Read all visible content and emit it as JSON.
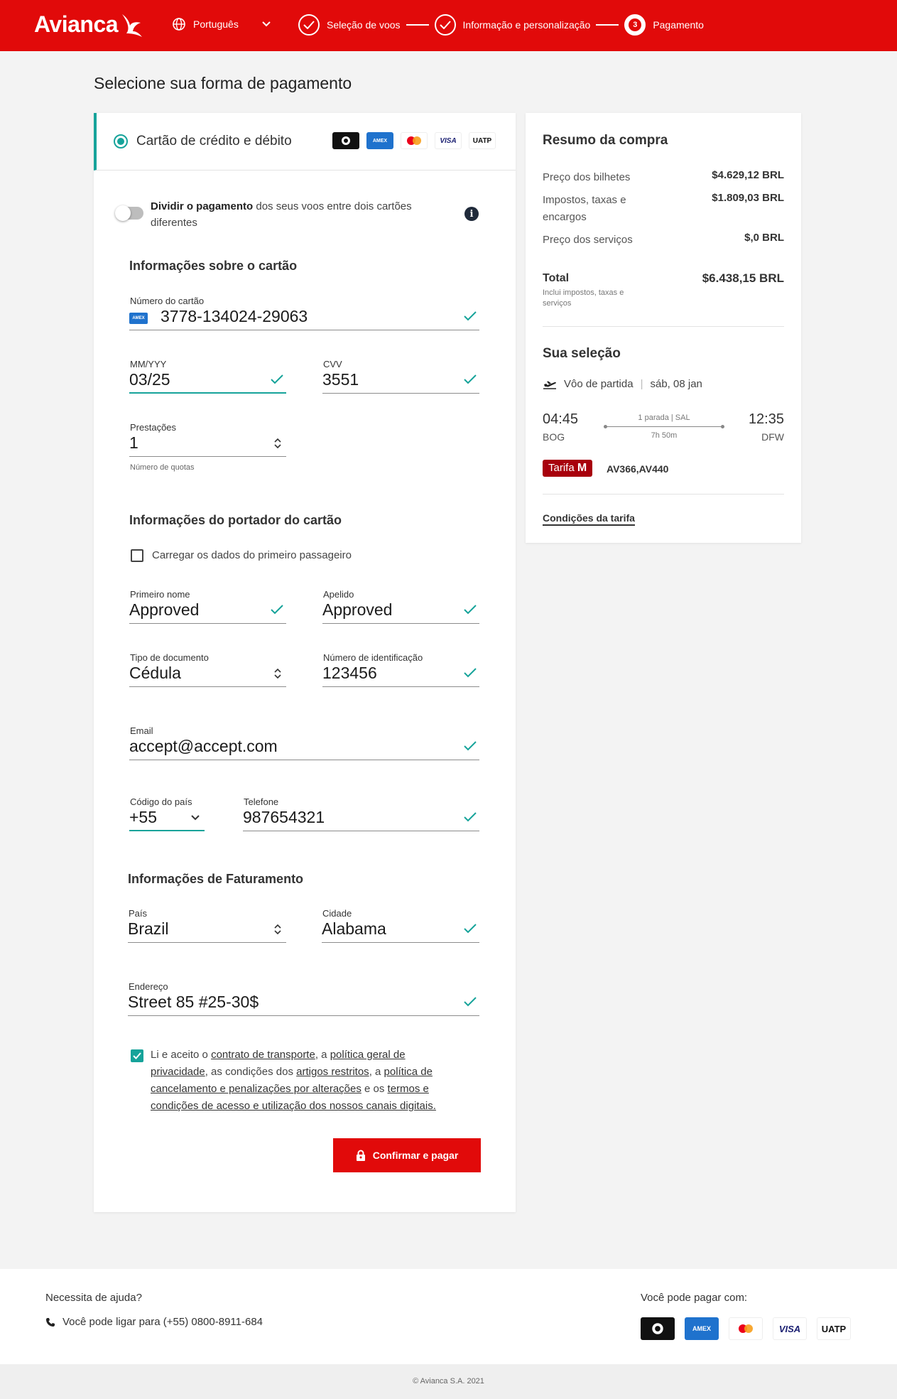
{
  "header": {
    "brand": "Avianca",
    "language": "Português",
    "steps": [
      {
        "label": "Seleção de voos"
      },
      {
        "label": "Informação e personalização"
      },
      {
        "number": "3",
        "label": "Pagamento"
      }
    ]
  },
  "page_title": "Selecione sua forma de pagamento",
  "payment_method": {
    "label": "Cartão de crédito e débito",
    "logos": [
      "Diners Club",
      "AMEX",
      "Mastercard",
      "VISA",
      "UATP"
    ]
  },
  "split": {
    "bold": "Dividir o pagamento",
    "text": " dos seus voos entre dois cartões diferentes",
    "info_glyph": "i"
  },
  "card_info": {
    "title": "Informações sobre o cartão",
    "number_label": "Número do cartão",
    "number_value": "3778-134024-29063",
    "expiry_label": "MM/YYY",
    "expiry_value": "03/25",
    "cvv_label": "CVV",
    "cvv_value": "3551",
    "installments_label": "Prestações",
    "installments_value": "1",
    "installments_hint": "Número de quotas"
  },
  "holder": {
    "title": "Informações do portador do cartão",
    "load_label": "Carregar os dados do primeiro passageiro",
    "first_name_label": "Primeiro nome",
    "first_name_value": "Approved",
    "last_name_label": "Apelido",
    "last_name_value": "Approved",
    "doc_type_label": "Tipo de documento",
    "doc_type_value": "Cédula",
    "id_label": "Número de identificação",
    "id_value": "123456",
    "email_label": "Email",
    "email_value": "accept@accept.com",
    "country_code_label": "Código do país",
    "country_code_value": "+55",
    "phone_label": "Telefone",
    "phone_value": "987654321"
  },
  "billing": {
    "title": "Informações de Faturamento",
    "country_label": "País",
    "country_value": "Brazil",
    "city_label": "Cidade",
    "city_value": "Alabama",
    "address_label": "Endereço",
    "address_value": "Street 85 #25-30$"
  },
  "terms": {
    "t1": "Li e aceito o ",
    "l1": "contrato de transporte",
    "t2": ", a ",
    "l2": "política geral de privacidade",
    "t3": ", as condições dos ",
    "l3": "artigos restritos",
    "t4": ", a ",
    "l4": "política de cancelamento e penalizações por alterações",
    "t5": " e os ",
    "l5": "termos e condições de acesso e utilização dos nossos canais digitais."
  },
  "pay_button": "Confirmar e pagar",
  "summary": {
    "title": "Resumo da compra",
    "tickets_label": "Preço dos bilhetes",
    "tickets_value": "$4.629,12 BRL",
    "taxes_label": "Impostos, taxas e encargos",
    "taxes_value": "$1.809,03 BRL",
    "services_label": "Preço dos serviços",
    "services_value": "$,0 BRL",
    "total_label": "Total",
    "total_sub": "Inclui impostos, taxas e serviços",
    "total_value": "$6.438,15 BRL",
    "selection_title": "Sua seleção",
    "flight_label": "Vôo de partida",
    "flight_date": "sáb, 08 jan",
    "depart_time": "04:45",
    "depart_code": "BOG",
    "arrive_time": "12:35",
    "arrive_code": "DFW",
    "stops": "1 parada | SAL",
    "duration": "7h 50m",
    "fare_prefix": "Tarifa",
    "fare_class": "M",
    "flight_numbers": "AV366,AV440",
    "fare_conditions": "Condições da tarifa"
  },
  "footer": {
    "help_title": "Necessita de ajuda?",
    "help_phone": "Você pode ligar para (+55) 0800-8911-684",
    "pay_with": "Você pode pagar com:",
    "copyright": "© Avianca S.A. 2021"
  },
  "colors": {
    "brand_red": "#e10a0a",
    "accent_teal": "#16a39a",
    "fare_badge": "#a8000c"
  }
}
